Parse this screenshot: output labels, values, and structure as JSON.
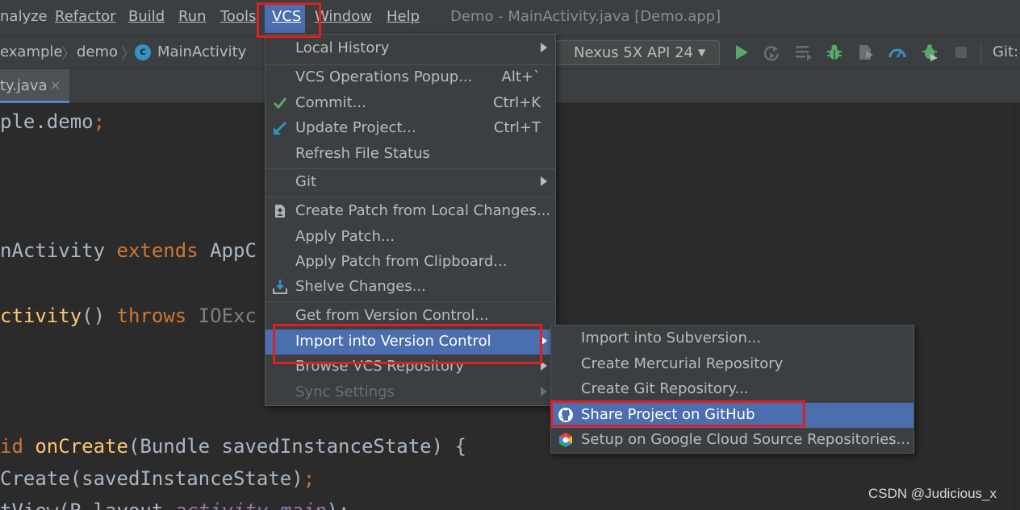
{
  "menubar": {
    "items": [
      {
        "label": "nalyze"
      },
      {
        "label": "Refactor"
      },
      {
        "label": "Build"
      },
      {
        "label": "Run"
      },
      {
        "label": "Tools"
      },
      {
        "label": "VCS"
      },
      {
        "label": "Window"
      },
      {
        "label": "Help"
      }
    ],
    "window_title": "Demo - MainActivity.java [Demo.app]"
  },
  "navbar": {
    "breadcrumbs": [
      "example",
      "demo",
      "MainActivity"
    ],
    "class_icon_letter": "c",
    "device": "Nexus 5X API 24",
    "git_label": "Git:"
  },
  "tab": {
    "label": "ty.java",
    "close": "×"
  },
  "editor": {
    "lines": {
      "l1a": "ple.demo",
      "l1b": ";",
      "l2a": "nActivity ",
      "l2b": "extends ",
      "l2c": "AppC",
      "l3a": "ctivity",
      "l3b": "() ",
      "l3c": "throws ",
      "l3d": "IOExc",
      "l4a": "id ",
      "l4b": "onCreate",
      "l4c": "(Bundle savedInstanceState) {",
      "l5a": "Create(savedInstanceState)",
      "l5b": ";",
      "l6a": "tView(R.layout.",
      "l6b": "activity_main",
      "l6c": ");"
    }
  },
  "vcs_menu": {
    "items": [
      {
        "label": "Local History",
        "submenu": true
      },
      {
        "label": "VCS Operations Popup...",
        "shortcut": "Alt+`"
      },
      {
        "label": "Commit...",
        "shortcut": "Ctrl+K",
        "icon": "check-icon"
      },
      {
        "label": "Update Project...",
        "shortcut": "Ctrl+T",
        "icon": "update-arrow-icon"
      },
      {
        "label": "Refresh File Status"
      },
      {
        "label": "Git",
        "submenu": true
      },
      {
        "label": "Create Patch from Local Changes...",
        "icon": "patch-icon"
      },
      {
        "label": "Apply Patch..."
      },
      {
        "label": "Apply Patch from Clipboard..."
      },
      {
        "label": "Shelve Changes...",
        "icon": "shelve-icon"
      },
      {
        "label": "Get from Version Control..."
      },
      {
        "label": "Import into Version Control",
        "submenu": true,
        "highlighted": true
      },
      {
        "label": "Browse VCS Repository",
        "submenu": true
      },
      {
        "label": "Sync Settings",
        "submenu": true,
        "disabled": true
      }
    ]
  },
  "import_menu": {
    "items": [
      {
        "label": "Import into Subversion..."
      },
      {
        "label": "Create Mercurial Repository"
      },
      {
        "label": "Create Git Repository..."
      },
      {
        "label": "Share Project on GitHub",
        "icon": "github-icon",
        "highlighted": true
      },
      {
        "label": "Setup on Google Cloud Source Repositories...",
        "icon": "google-cloud-icon"
      }
    ]
  },
  "colors": {
    "accent": "#4b6eaf",
    "annotation_box": "#e02020",
    "keyword": "#cc7832",
    "function": "#ffc66d"
  },
  "watermark": "CSDN @Judicious_x"
}
